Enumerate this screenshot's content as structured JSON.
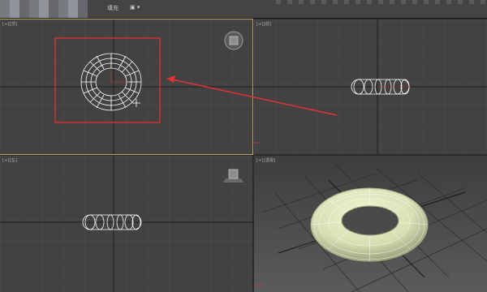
{
  "toolbar": {
    "label_1": "填充",
    "label_2": "▣ ▾"
  },
  "viewports": [
    {
      "id": "top",
      "tag": "[+][顶]"
    },
    {
      "id": "front",
      "tag": "[+][前]"
    },
    {
      "id": "left",
      "tag": "[+][左]"
    },
    {
      "id": "perspective",
      "tag": "[+][透视]"
    }
  ],
  "colors": {
    "viewport_bg": "#424242",
    "grid": "#4d4d4d",
    "axis": "#1f1f1f",
    "highlight_box": "#e03232",
    "arrow": "#e03232",
    "torus_wire": "#ffffff",
    "torus_fill": "#d7dfb3"
  }
}
